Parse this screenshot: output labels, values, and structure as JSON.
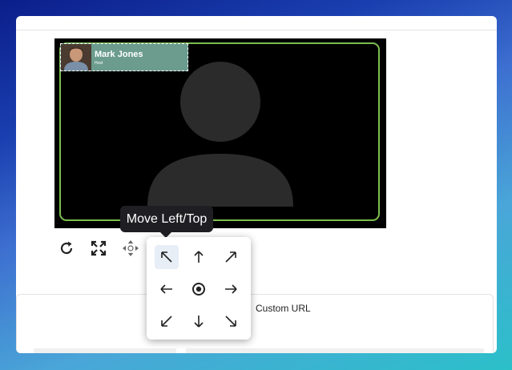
{
  "video": {
    "participant_name": "Mark Jones",
    "participant_role": "Host"
  },
  "controls": {
    "refresh_icon": "refresh-icon",
    "fullscreen_icon": "expand-icon",
    "move_icon": "move-icon"
  },
  "tooltip": {
    "text": "Move Left/Top"
  },
  "position_picker": {
    "options": [
      "up-left",
      "up",
      "up-right",
      "left",
      "center",
      "right",
      "down-left",
      "down",
      "down-right"
    ],
    "selected": "up-left"
  },
  "settings": {
    "custom_url_label": "Custom URL"
  },
  "colors": {
    "frame_border": "#7dbe4f",
    "nameplate_bg": "#6b9c8e",
    "tooltip_bg": "#1f1f23"
  }
}
